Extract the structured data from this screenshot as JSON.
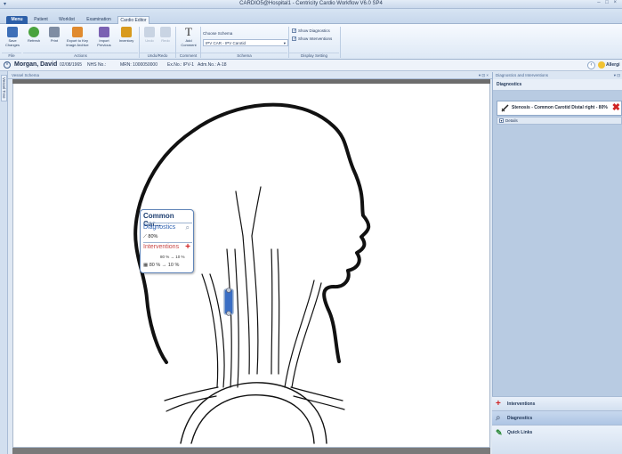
{
  "window": {
    "title": "CARDIO5@Hospital1 - Centricity Cardio Workflow V6.0 SP4",
    "controls": "– □ ×"
  },
  "tabs": [
    {
      "label": "Menu"
    },
    {
      "label": "Patient"
    },
    {
      "label": "Worklist"
    },
    {
      "label": "Examination"
    },
    {
      "label": "Cardio Editor"
    }
  ],
  "ribbon": {
    "buttons": [
      {
        "label": "Save Changes"
      },
      {
        "label": "Refresh"
      },
      {
        "label": "Print"
      },
      {
        "label": "Export to Key Image Archive"
      },
      {
        "label": "Import Previous"
      },
      {
        "label": "Inventory"
      },
      {
        "label": "Undo"
      },
      {
        "label": "Redo"
      },
      {
        "label": "Add Comment"
      }
    ],
    "groups": [
      "File",
      "Actions",
      "Undo/Redo",
      "Comment",
      "Schema",
      "Display Setting"
    ],
    "schema_label": "Choose Schema",
    "schema_value": "IPV CAR - IPV Carotid",
    "show_diagnostics": "Show Diagnostics",
    "show_interventions": "Show Interventions"
  },
  "patient": {
    "name": "Morgan, David",
    "dob": "02/08/1965",
    "nhs": "NHS No.:",
    "mrn": "MRN: 1000050000",
    "ex": "Ex.No.: IPV-1",
    "adm": "Adm.No.: A-18",
    "allergy": "Allergi"
  },
  "left_tab": "Vessel Tree",
  "vessel_panel": {
    "title": "Vessel Schema",
    "controls": "▾ ⊡ ×"
  },
  "popup": {
    "title": "Common Car...",
    "diagnostics": "Diagnostics",
    "diag_value": "80%",
    "interventions": "Interventions",
    "interv_value1": "80 % → 10 %",
    "interv_value2": "80 % → 10 %"
  },
  "right_panel": {
    "title": "Diagnostics and Interventions",
    "controls": "▾ ⊡",
    "section": "Diagnostics",
    "item": "Stenosis - Common Carotid Distal right - 80%",
    "details": "Details",
    "nav": [
      {
        "label": "Interventions"
      },
      {
        "label": "Diagnostics"
      },
      {
        "label": "Quick Links"
      }
    ]
  },
  "colors": {
    "accent": "#2d5fa8",
    "danger": "#d02323",
    "stent": "#3a6ec4"
  }
}
